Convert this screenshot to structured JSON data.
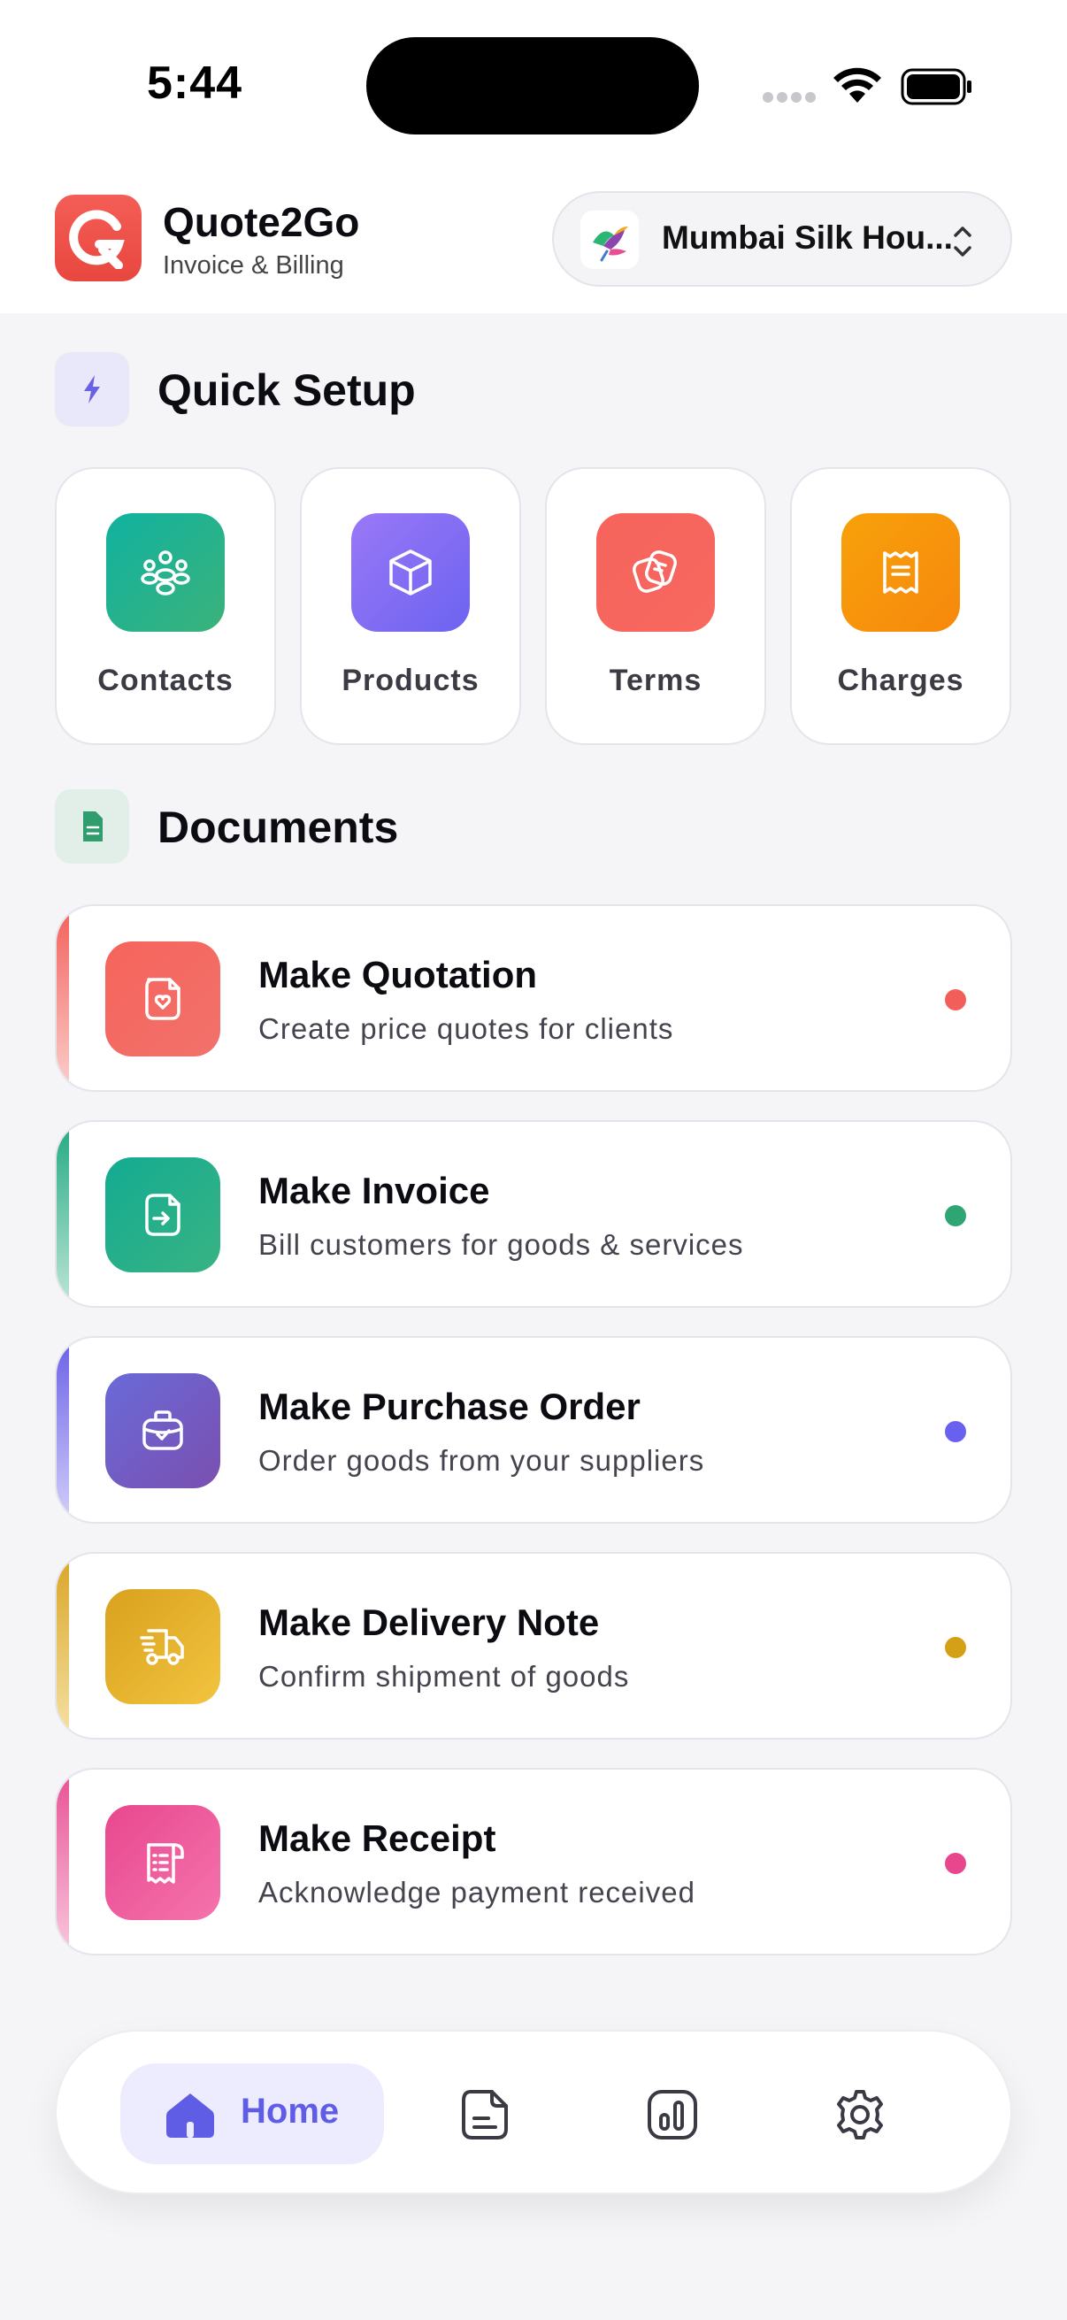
{
  "status": {
    "time": "5:44"
  },
  "header": {
    "app_name": "Quote2Go",
    "app_subtitle": "Invoice & Billing",
    "business_name": "Mumbai Silk Hou..."
  },
  "quick_setup": {
    "title": "Quick Setup",
    "items": [
      {
        "label": "Contacts",
        "icon": "contacts-icon",
        "color": "#16b29a"
      },
      {
        "label": "Products",
        "icon": "box-icon",
        "color": "#7b6cf5"
      },
      {
        "label": "Terms",
        "icon": "terms-icon",
        "color": "#f25f5a"
      },
      {
        "label": "Charges",
        "icon": "receipt-icon",
        "color": "#f58a0c"
      }
    ]
  },
  "documents": {
    "title": "Documents",
    "items": [
      {
        "title": "Make Quotation",
        "subtitle": "Create price quotes for clients",
        "color": "#f25f5a"
      },
      {
        "title": "Make Invoice",
        "subtitle": "Bill customers for goods & services",
        "color": "#22a982"
      },
      {
        "title": "Make Purchase Order",
        "subtitle": "Order goods from your suppliers",
        "color": "#6a60e6"
      },
      {
        "title": "Make Delivery Note",
        "subtitle": "Confirm shipment of goods",
        "color": "#d9a524"
      },
      {
        "title": "Make Receipt",
        "subtitle": "Acknowledge payment received",
        "color": "#e84f93"
      }
    ]
  },
  "tab_bar": {
    "active": "Home",
    "items": [
      "home-icon",
      "documents-icon",
      "reports-icon",
      "settings-icon"
    ]
  }
}
